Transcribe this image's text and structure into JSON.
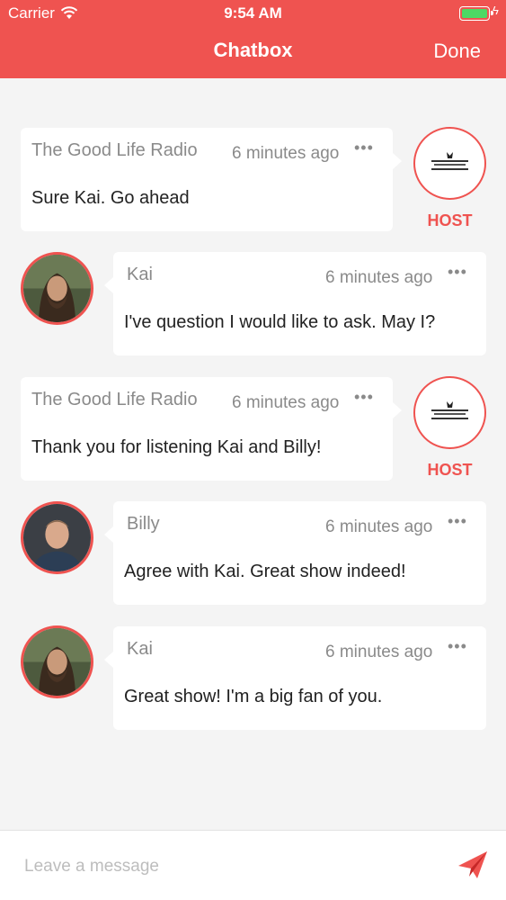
{
  "status_bar": {
    "carrier": "Carrier",
    "time": "9:54 AM"
  },
  "nav": {
    "title": "Chatbox",
    "done_label": "Done"
  },
  "host_label": "HOST",
  "messages": [
    {
      "sender": "The Good Life Radio",
      "time": "6 minutes ago",
      "text": "Sure Kai. Go ahead",
      "role": "host"
    },
    {
      "sender": "Kai",
      "time": "6 minutes ago",
      "text": "I've question I would like to ask. May I?",
      "role": "user"
    },
    {
      "sender": "The Good Life Radio",
      "time": "6 minutes ago",
      "text": "Thank you for listening Kai and Billy!",
      "role": "host"
    },
    {
      "sender": "Billy",
      "time": "6 minutes ago",
      "text": "Agree with Kai. Great show indeed!",
      "role": "user"
    },
    {
      "sender": "Kai",
      "time": "6 minutes ago",
      "text": "Great show! I'm a big fan of you.",
      "role": "user"
    }
  ],
  "more_glyph": "•••",
  "composer": {
    "placeholder": "Leave a message"
  },
  "colors": {
    "accent": "#ef5350",
    "battery": "#4cd964",
    "background": "#f4f4f4"
  },
  "icons": {
    "wifi": "wifi-icon",
    "battery": "battery-icon",
    "more": "more-icon",
    "send": "send-icon",
    "host_logo": "radio-logo-icon"
  }
}
